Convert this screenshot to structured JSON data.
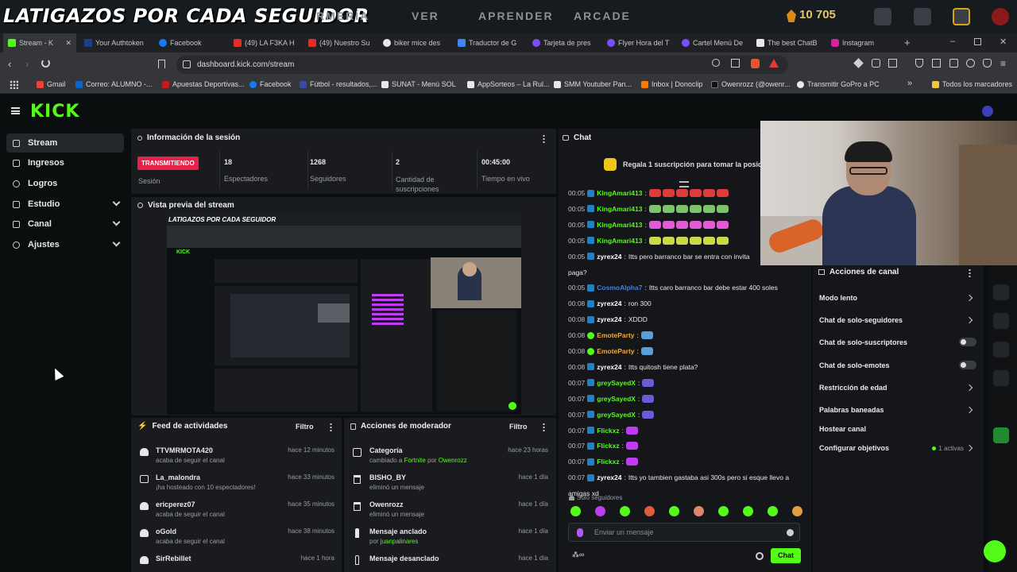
{
  "overlay": {
    "title": "LATIGAZOS POR CADA SEGUIDOR",
    "nav": [
      "RMERÍA",
      "VER",
      "APRENDER",
      "ARCADE"
    ],
    "coins": "10 705"
  },
  "browser": {
    "tabs": [
      "Stream - K",
      "Your Authtoken",
      "Facebook",
      "(49) LA F3KA H",
      "(49) Nuestro Su",
      "biker mice des",
      "Traductor de G",
      "Tarjeta de pres",
      "Flyer Hora del T",
      "Cartel Menú De",
      "The best ChatB",
      "Instagram"
    ],
    "url": "dashboard.kick.com/stream",
    "bookmarks": [
      "Gmail",
      "Correo: ALUMNO -...",
      "Apuestas Deportivas...",
      "Facebook",
      "Fútbol - resultados,...",
      "SUNAT - Menú SOL",
      "AppSorteos – La Rul...",
      "SMM Youtuber Pan...",
      "Inbox | Donoclip",
      "Owenrozz (@owenr...",
      "Transmitir GoPro a PC"
    ],
    "bookmarks_all": "Todos los marcadores"
  },
  "sidebar": {
    "items": [
      {
        "label": "Stream"
      },
      {
        "label": "Ingresos"
      },
      {
        "label": "Logros"
      },
      {
        "label": "Estudio"
      },
      {
        "label": "Canal"
      },
      {
        "label": "Ajustes"
      }
    ]
  },
  "session": {
    "title": "Información de la sesión",
    "status_badge": "TRANSMITIENDO",
    "status_label": "Sesión",
    "stats": [
      {
        "value": "18",
        "label": "Espectadores"
      },
      {
        "value": "1268",
        "label": "Seguidores"
      },
      {
        "value": "2",
        "label": "Cantidad de suscripciones"
      },
      {
        "value": "00:45:00",
        "label": "Tiempo en vivo"
      }
    ]
  },
  "preview": {
    "title": "Vista previa del stream",
    "overlay_text": "LATIGAZOS POR CADA SEGUIDOR"
  },
  "feed": {
    "title": "Feed de actividades",
    "filter": "Filtro",
    "items": [
      {
        "name": "TTVMRMOTA420",
        "desc": "acaba de seguir el canal",
        "time": "hace 12 minutos"
      },
      {
        "name": "La_malondra",
        "desc": "¡ha hosteado con 10 espectadores!",
        "time": "hace 33 minutos"
      },
      {
        "name": "ericperez07",
        "desc": "acaba de seguir el canal",
        "time": "hace 35 minutos"
      },
      {
        "name": "oGold",
        "desc": "acaba de seguir el canal",
        "time": "hace 38 minutos"
      },
      {
        "name": "SirRebillet",
        "desc": "",
        "time": "hace 1 hora"
      }
    ]
  },
  "modactions": {
    "title": "Acciones de moderador",
    "filter": "Filtro",
    "items": [
      {
        "name": "Categoría",
        "desc_a": "cambiado a ",
        "desc_b": "Fortnite",
        "desc_c": " por ",
        "desc_d": "Owenrozz",
        "time": "hace 23 horas"
      },
      {
        "name": "BISHO_BY",
        "desc_a": "eliminó un mensaje",
        "desc_b": "",
        "desc_c": "",
        "desc_d": "",
        "time": "hace 1 día"
      },
      {
        "name": "Owenrozz",
        "desc_a": "eliminó un mensaje",
        "desc_b": "",
        "desc_c": "",
        "desc_d": "",
        "time": "hace 1 día"
      },
      {
        "name": "Mensaje anclado",
        "desc_a": "por ",
        "desc_b": "juanpalinares",
        "desc_c": "",
        "desc_d": "",
        "time": "hace 1 día"
      },
      {
        "name": "Mensaje desanclado",
        "desc_a": "",
        "desc_b": "",
        "desc_c": "",
        "desc_d": "",
        "time": "hace 1 día"
      }
    ]
  },
  "chat": {
    "title": "Chat",
    "promo": "Regala 1 suscripción para tomar la posición",
    "lines": [
      {
        "time": "00:05",
        "user": "KingAmari413",
        "color": "#53fc18",
        "text": "",
        "emote": "#e03b3b"
      },
      {
        "time": "00:05",
        "user": "KingAmari413",
        "color": "#53fc18",
        "text": "",
        "emote": "#7dc36a"
      },
      {
        "time": "00:05",
        "user": "KingAmari413",
        "color": "#53fc18",
        "text": "",
        "emote": "#e05bd6"
      },
      {
        "time": "00:05",
        "user": "KingAmari413",
        "color": "#53fc18",
        "text": "",
        "emote": "#c9d948"
      },
      {
        "time": "00:05",
        "user": "zyrex24",
        "color": "#ffffff",
        "text": "Itts pero barranco bar se entra con invita",
        "emote": ""
      },
      {
        "time": "",
        "user": "",
        "color": "#ffffff",
        "text": "paga?",
        "emote": ""
      },
      {
        "time": "00:05",
        "user": "CosmoAlpha7",
        "color": "#3f7fe6",
        "text": "Itts caro barranco bar debe estar 400 soles",
        "emote": ""
      },
      {
        "time": "00:08",
        "user": "zyrex24",
        "color": "#ffffff",
        "text": "ron 300",
        "emote": ""
      },
      {
        "time": "00:08",
        "user": "zyrex24",
        "color": "#ffffff",
        "text": "XDDD",
        "emote": ""
      },
      {
        "time": "00:08",
        "user": "EmoteParty",
        "color": "#f2a93b",
        "text": "",
        "emote": "#5aa0d8"
      },
      {
        "time": "00:08",
        "user": "EmoteParty",
        "color": "#f2a93b",
        "text": "",
        "emote": "#5aa0d8"
      },
      {
        "time": "00:08",
        "user": "zyrex24",
        "color": "#ffffff",
        "text": "Itts quitosh tiene plata?",
        "emote": ""
      },
      {
        "time": "00:07",
        "user": "greySayedX",
        "color": "#53fc18",
        "text": "",
        "emote": "#6b5bd6"
      },
      {
        "time": "00:07",
        "user": "greySayedX",
        "color": "#53fc18",
        "text": "",
        "emote": "#6b5bd6"
      },
      {
        "time": "00:07",
        "user": "greySayedX",
        "color": "#53fc18",
        "text": "",
        "emote": "#6b5bd6"
      },
      {
        "time": "00:07",
        "user": "Flickxz",
        "color": "#53fc18",
        "text": "",
        "emote": "#c03cf0"
      },
      {
        "time": "00:07",
        "user": "Flickxz",
        "color": "#53fc18",
        "text": "",
        "emote": "#c03cf0"
      },
      {
        "time": "00:07",
        "user": "Flickxz",
        "color": "#53fc18",
        "text": "",
        "emote": "#c03cf0"
      },
      {
        "time": "00:07",
        "user": "zyrex24",
        "color": "#ffffff",
        "text": "Itts yo tambien gastaba asi 300s pero si esque llevo a",
        "emote": ""
      },
      {
        "time": "",
        "user": "",
        "color": "#ffffff",
        "text": "amigas xd",
        "emote": ""
      }
    ],
    "followers_only": "Solo seguidores",
    "input_placeholder": "Enviar un mensaje",
    "send": "Chat"
  },
  "channel_actions": {
    "title": "Acciones de canal",
    "items": [
      {
        "label": "Modo lento",
        "control": "chevron"
      },
      {
        "label": "Chat de solo-seguidores",
        "control": "chevron"
      },
      {
        "label": "Chat de solo-suscriptores",
        "control": "toggle"
      },
      {
        "label": "Chat de solo-emotes",
        "control": "toggle"
      },
      {
        "label": "Restricción de edad",
        "control": "chevron"
      },
      {
        "label": "Palabras baneadas",
        "control": "chevron"
      },
      {
        "label": "Hostear canal",
        "control": "none"
      },
      {
        "label": "Configurar objetivos",
        "control": "chevron",
        "badge": "1 activas"
      }
    ]
  },
  "colors": {
    "accent": "#53fc18",
    "live": "#e5214a",
    "bg": "#0b0e0f",
    "panel": "#191b1f"
  }
}
